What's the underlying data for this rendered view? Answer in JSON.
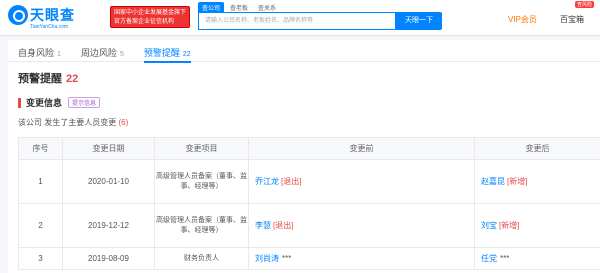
{
  "header": {
    "logo_text": "天眼查",
    "logo_sub": "TianYanCha.com",
    "banner": "国家中小企业发展基金旗下官方备案企业征信机构",
    "search_tabs": [
      "查公司",
      "查老板",
      "查关系"
    ],
    "search_placeholder": "请输入公司名称、老板姓名、品牌名称等",
    "search_button": "天眼一下",
    "vip_label": "VIP会员",
    "user_name": "百宝箱",
    "user_badge": "查风险"
  },
  "tabs": [
    {
      "label": "自身风险",
      "count": "1"
    },
    {
      "label": "周边风险",
      "count": "5"
    },
    {
      "label": "预警提醒",
      "count": "22"
    }
  ],
  "section": {
    "title": "预警提醒",
    "count": "22"
  },
  "subsection": {
    "title": "变更信息",
    "tip_button": "提示信息"
  },
  "summary": {
    "prefix": "该公司 发生了主要人员变更",
    "count": "(6)"
  },
  "table": {
    "headers": [
      "序号",
      "变更日期",
      "变更项目",
      "变更前",
      "变更后"
    ],
    "rows": [
      {
        "no": "1",
        "date": "2020-01-10",
        "item": "高级管理人员备案（董事、监事、经理等）",
        "before_name": "乔江龙",
        "before_tag": "[退出]",
        "after_name": "赵嘉昆",
        "after_tag": "[新增]"
      },
      {
        "no": "2",
        "date": "2019-12-12",
        "item": "高级管理人员备案（董事、监事、经理等）",
        "before_name": "李慧",
        "before_tag": "[退出]",
        "after_name": "刘宝",
        "after_tag": "[新增]"
      },
      {
        "no": "3",
        "date": "2019-08-09",
        "item": "财务负责人",
        "before_name": "刘尚涛",
        "before_tag": "***",
        "after_name": "任党",
        "after_tag": "***"
      }
    ]
  }
}
